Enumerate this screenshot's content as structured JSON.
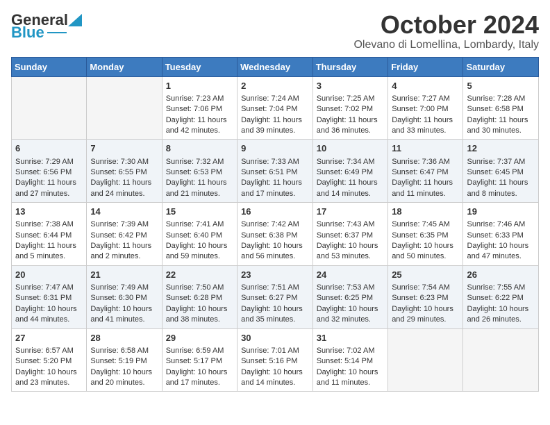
{
  "header": {
    "logo_text_general": "General",
    "logo_text_blue": "Blue",
    "month_title": "October 2024",
    "location": "Olevano di Lomellina, Lombardy, Italy"
  },
  "weekdays": [
    "Sunday",
    "Monday",
    "Tuesday",
    "Wednesday",
    "Thursday",
    "Friday",
    "Saturday"
  ],
  "weeks": [
    [
      {
        "day": "",
        "content": ""
      },
      {
        "day": "",
        "content": ""
      },
      {
        "day": "1",
        "content": "Sunrise: 7:23 AM\nSunset: 7:06 PM\nDaylight: 11 hours and 42 minutes."
      },
      {
        "day": "2",
        "content": "Sunrise: 7:24 AM\nSunset: 7:04 PM\nDaylight: 11 hours and 39 minutes."
      },
      {
        "day": "3",
        "content": "Sunrise: 7:25 AM\nSunset: 7:02 PM\nDaylight: 11 hours and 36 minutes."
      },
      {
        "day": "4",
        "content": "Sunrise: 7:27 AM\nSunset: 7:00 PM\nDaylight: 11 hours and 33 minutes."
      },
      {
        "day": "5",
        "content": "Sunrise: 7:28 AM\nSunset: 6:58 PM\nDaylight: 11 hours and 30 minutes."
      }
    ],
    [
      {
        "day": "6",
        "content": "Sunrise: 7:29 AM\nSunset: 6:56 PM\nDaylight: 11 hours and 27 minutes."
      },
      {
        "day": "7",
        "content": "Sunrise: 7:30 AM\nSunset: 6:55 PM\nDaylight: 11 hours and 24 minutes."
      },
      {
        "day": "8",
        "content": "Sunrise: 7:32 AM\nSunset: 6:53 PM\nDaylight: 11 hours and 21 minutes."
      },
      {
        "day": "9",
        "content": "Sunrise: 7:33 AM\nSunset: 6:51 PM\nDaylight: 11 hours and 17 minutes."
      },
      {
        "day": "10",
        "content": "Sunrise: 7:34 AM\nSunset: 6:49 PM\nDaylight: 11 hours and 14 minutes."
      },
      {
        "day": "11",
        "content": "Sunrise: 7:36 AM\nSunset: 6:47 PM\nDaylight: 11 hours and 11 minutes."
      },
      {
        "day": "12",
        "content": "Sunrise: 7:37 AM\nSunset: 6:45 PM\nDaylight: 11 hours and 8 minutes."
      }
    ],
    [
      {
        "day": "13",
        "content": "Sunrise: 7:38 AM\nSunset: 6:44 PM\nDaylight: 11 hours and 5 minutes."
      },
      {
        "day": "14",
        "content": "Sunrise: 7:39 AM\nSunset: 6:42 PM\nDaylight: 11 hours and 2 minutes."
      },
      {
        "day": "15",
        "content": "Sunrise: 7:41 AM\nSunset: 6:40 PM\nDaylight: 10 hours and 59 minutes."
      },
      {
        "day": "16",
        "content": "Sunrise: 7:42 AM\nSunset: 6:38 PM\nDaylight: 10 hours and 56 minutes."
      },
      {
        "day": "17",
        "content": "Sunrise: 7:43 AM\nSunset: 6:37 PM\nDaylight: 10 hours and 53 minutes."
      },
      {
        "day": "18",
        "content": "Sunrise: 7:45 AM\nSunset: 6:35 PM\nDaylight: 10 hours and 50 minutes."
      },
      {
        "day": "19",
        "content": "Sunrise: 7:46 AM\nSunset: 6:33 PM\nDaylight: 10 hours and 47 minutes."
      }
    ],
    [
      {
        "day": "20",
        "content": "Sunrise: 7:47 AM\nSunset: 6:31 PM\nDaylight: 10 hours and 44 minutes."
      },
      {
        "day": "21",
        "content": "Sunrise: 7:49 AM\nSunset: 6:30 PM\nDaylight: 10 hours and 41 minutes."
      },
      {
        "day": "22",
        "content": "Sunrise: 7:50 AM\nSunset: 6:28 PM\nDaylight: 10 hours and 38 minutes."
      },
      {
        "day": "23",
        "content": "Sunrise: 7:51 AM\nSunset: 6:27 PM\nDaylight: 10 hours and 35 minutes."
      },
      {
        "day": "24",
        "content": "Sunrise: 7:53 AM\nSunset: 6:25 PM\nDaylight: 10 hours and 32 minutes."
      },
      {
        "day": "25",
        "content": "Sunrise: 7:54 AM\nSunset: 6:23 PM\nDaylight: 10 hours and 29 minutes."
      },
      {
        "day": "26",
        "content": "Sunrise: 7:55 AM\nSunset: 6:22 PM\nDaylight: 10 hours and 26 minutes."
      }
    ],
    [
      {
        "day": "27",
        "content": "Sunrise: 6:57 AM\nSunset: 5:20 PM\nDaylight: 10 hours and 23 minutes."
      },
      {
        "day": "28",
        "content": "Sunrise: 6:58 AM\nSunset: 5:19 PM\nDaylight: 10 hours and 20 minutes."
      },
      {
        "day": "29",
        "content": "Sunrise: 6:59 AM\nSunset: 5:17 PM\nDaylight: 10 hours and 17 minutes."
      },
      {
        "day": "30",
        "content": "Sunrise: 7:01 AM\nSunset: 5:16 PM\nDaylight: 10 hours and 14 minutes."
      },
      {
        "day": "31",
        "content": "Sunrise: 7:02 AM\nSunset: 5:14 PM\nDaylight: 10 hours and 11 minutes."
      },
      {
        "day": "",
        "content": ""
      },
      {
        "day": "",
        "content": ""
      }
    ]
  ]
}
